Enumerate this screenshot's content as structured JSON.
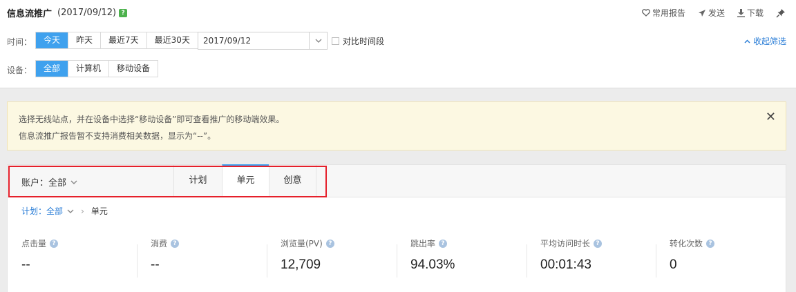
{
  "header": {
    "title": "信息流推广",
    "date": "(2017/09/12)",
    "actions": [
      {
        "label": "常用报告",
        "icon": "heart-icon"
      },
      {
        "label": "发送",
        "icon": "send-icon"
      },
      {
        "label": "下载",
        "icon": "download-icon"
      },
      {
        "icon": "pin-icon"
      }
    ]
  },
  "filters": {
    "time_label": "时间：",
    "time_options": [
      "今天",
      "昨天",
      "最近7天",
      "最近30天"
    ],
    "time_selected": "今天",
    "date_value": "2017/09/12",
    "compare_label": "对比时间段",
    "collapse_label": "收起筛选",
    "device_label": "设备：",
    "device_options": [
      "全部",
      "计算机",
      "移动设备"
    ],
    "device_selected": "全部"
  },
  "notice": {
    "line1": "选择无线站点，并在设备中选择“移动设备”即可查看推广的移动端效果。",
    "line2": "信息流推广报告暂不支持消费相关数据，显示为“--”。",
    "close": "✕"
  },
  "panel": {
    "account": "账户：全部",
    "tabs": [
      "计划",
      "单元",
      "创意"
    ],
    "active_tab": "单元",
    "breadcrumb": {
      "link": "计划：全部",
      "sep": "›",
      "current": "单元"
    },
    "metrics": [
      {
        "label": "点击量",
        "value": "--"
      },
      {
        "label": "消费",
        "value": "--"
      },
      {
        "label": "浏览量(PV)",
        "value": "12,709"
      },
      {
        "label": "跳出率",
        "value": "94.03%"
      },
      {
        "label": "平均访问时长",
        "value": "00:01:43"
      },
      {
        "label": "转化次数",
        "value": "0"
      }
    ]
  },
  "colors": {
    "accent": "#3fa1ee",
    "link": "#2b7ed7",
    "highlight_box": "#e5202b",
    "notice_bg": "#fcf8e2"
  }
}
